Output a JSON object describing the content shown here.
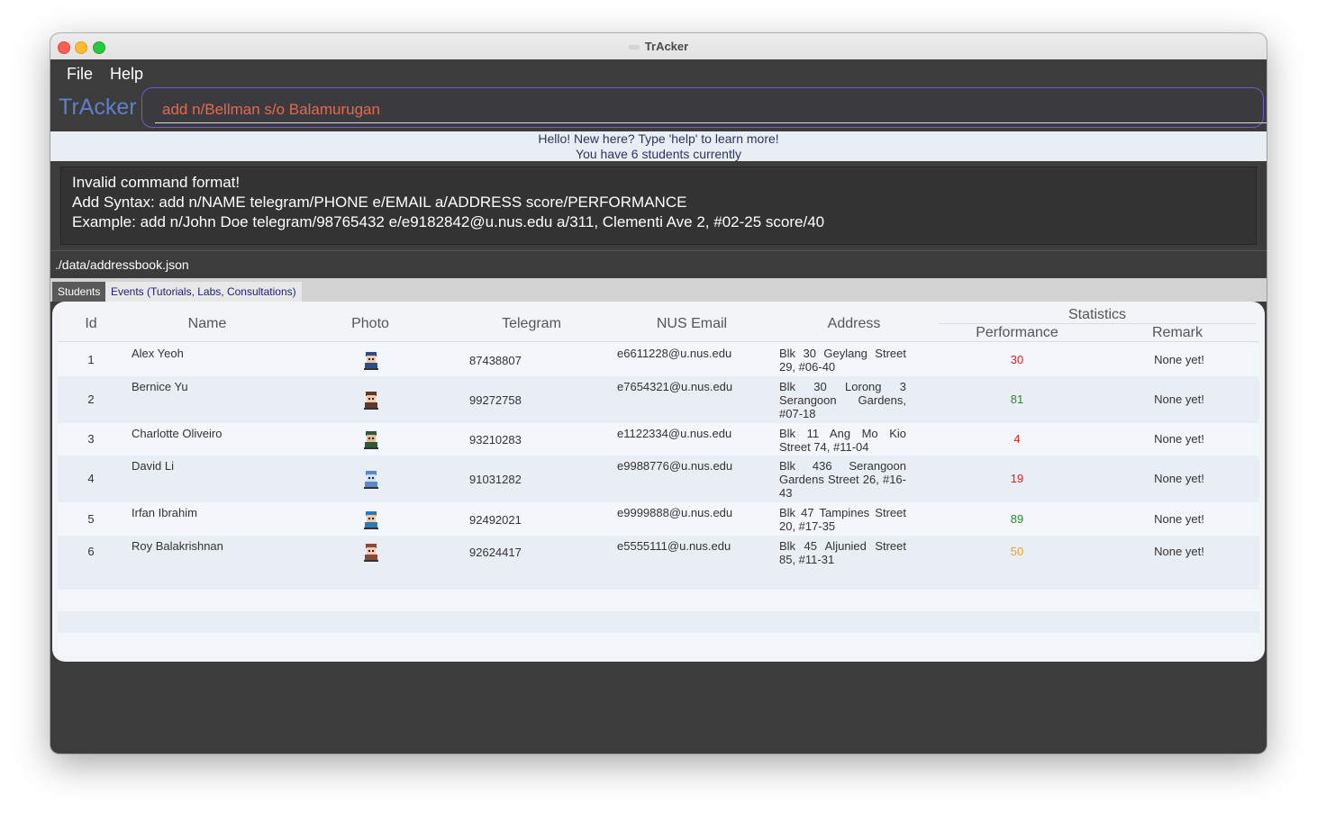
{
  "window": {
    "title": "TrAcker"
  },
  "menu": {
    "file": "File",
    "help": "Help"
  },
  "logo": "TrAcker",
  "command": {
    "value": "add n/Bellman s/o Balamurugan"
  },
  "greeting": {
    "line1": "Hello! New here? Type 'help' to learn more!",
    "line2": "You have 6 students currently"
  },
  "result": {
    "line1": "Invalid command format!",
    "line2": "Add Syntax: add n/NAME telegram/PHONE e/EMAIL a/ADDRESS score/PERFORMANCE",
    "line3": "Example: add n/John Doe telegram/98765432 e/e9182842@u.nus.edu a/311, Clementi Ave 2, #02-25 score/40"
  },
  "status_path": "./data/addressbook.json",
  "tabs": {
    "students": "Students",
    "events": "Events (Tutorials, Labs, Consultations)"
  },
  "table": {
    "headers": {
      "id": "Id",
      "name": "Name",
      "photo": "Photo",
      "telegram": "Telegram",
      "email": "NUS Email",
      "address": "Address",
      "statistics": "Statistics",
      "performance": "Performance",
      "remark": "Remark"
    },
    "rows": [
      {
        "id": "1",
        "name": "Alex Yeoh",
        "photo_icon": "student-avatar-icon",
        "telegram": "87438807",
        "email": "e6611228@u.nus.edu",
        "address": "Blk 30 Geylang Street 29, #06-40",
        "performance": "30",
        "perf_color": "#e02020",
        "remark": "None yet!"
      },
      {
        "id": "2",
        "name": "Bernice Yu",
        "photo_icon": "student-avatar-icon",
        "telegram": "99272758",
        "email": "e7654321@u.nus.edu",
        "address": "Blk 30 Lorong 3 Serangoon Gardens, #07-18",
        "performance": "81",
        "perf_color": "#2a8a2a",
        "remark": "None yet!"
      },
      {
        "id": "3",
        "name": "Charlotte Oliveiro",
        "photo_icon": "student-avatar-icon",
        "telegram": "93210283",
        "email": "e1122334@u.nus.edu",
        "address": "Blk 11 Ang Mo Kio Street 74, #11-04",
        "performance": "4",
        "perf_color": "#e02020",
        "remark": "None yet!"
      },
      {
        "id": "4",
        "name": "David Li",
        "photo_icon": "student-avatar-icon",
        "telegram": "91031282",
        "email": "e9988776@u.nus.edu",
        "address": "Blk 436 Serangoon Gardens Street 26, #16-43",
        "performance": "19",
        "perf_color": "#e02020",
        "remark": "None yet!"
      },
      {
        "id": "5",
        "name": "Irfan Ibrahim",
        "photo_icon": "student-avatar-icon",
        "telegram": "92492021",
        "email": "e9999888@u.nus.edu",
        "address": "Blk 47 Tampines Street 20, #17-35",
        "performance": "89",
        "perf_color": "#2a8a2a",
        "remark": "None yet!"
      },
      {
        "id": "6",
        "name": "Roy Balakrishnan",
        "photo_icon": "student-avatar-icon",
        "telegram": "92624417",
        "email": "e5555111@u.nus.edu",
        "address": "Blk 45 Aljunied Street 85, #11-31",
        "performance": "50",
        "perf_color": "#f0a020",
        "remark": "None yet!"
      }
    ]
  }
}
